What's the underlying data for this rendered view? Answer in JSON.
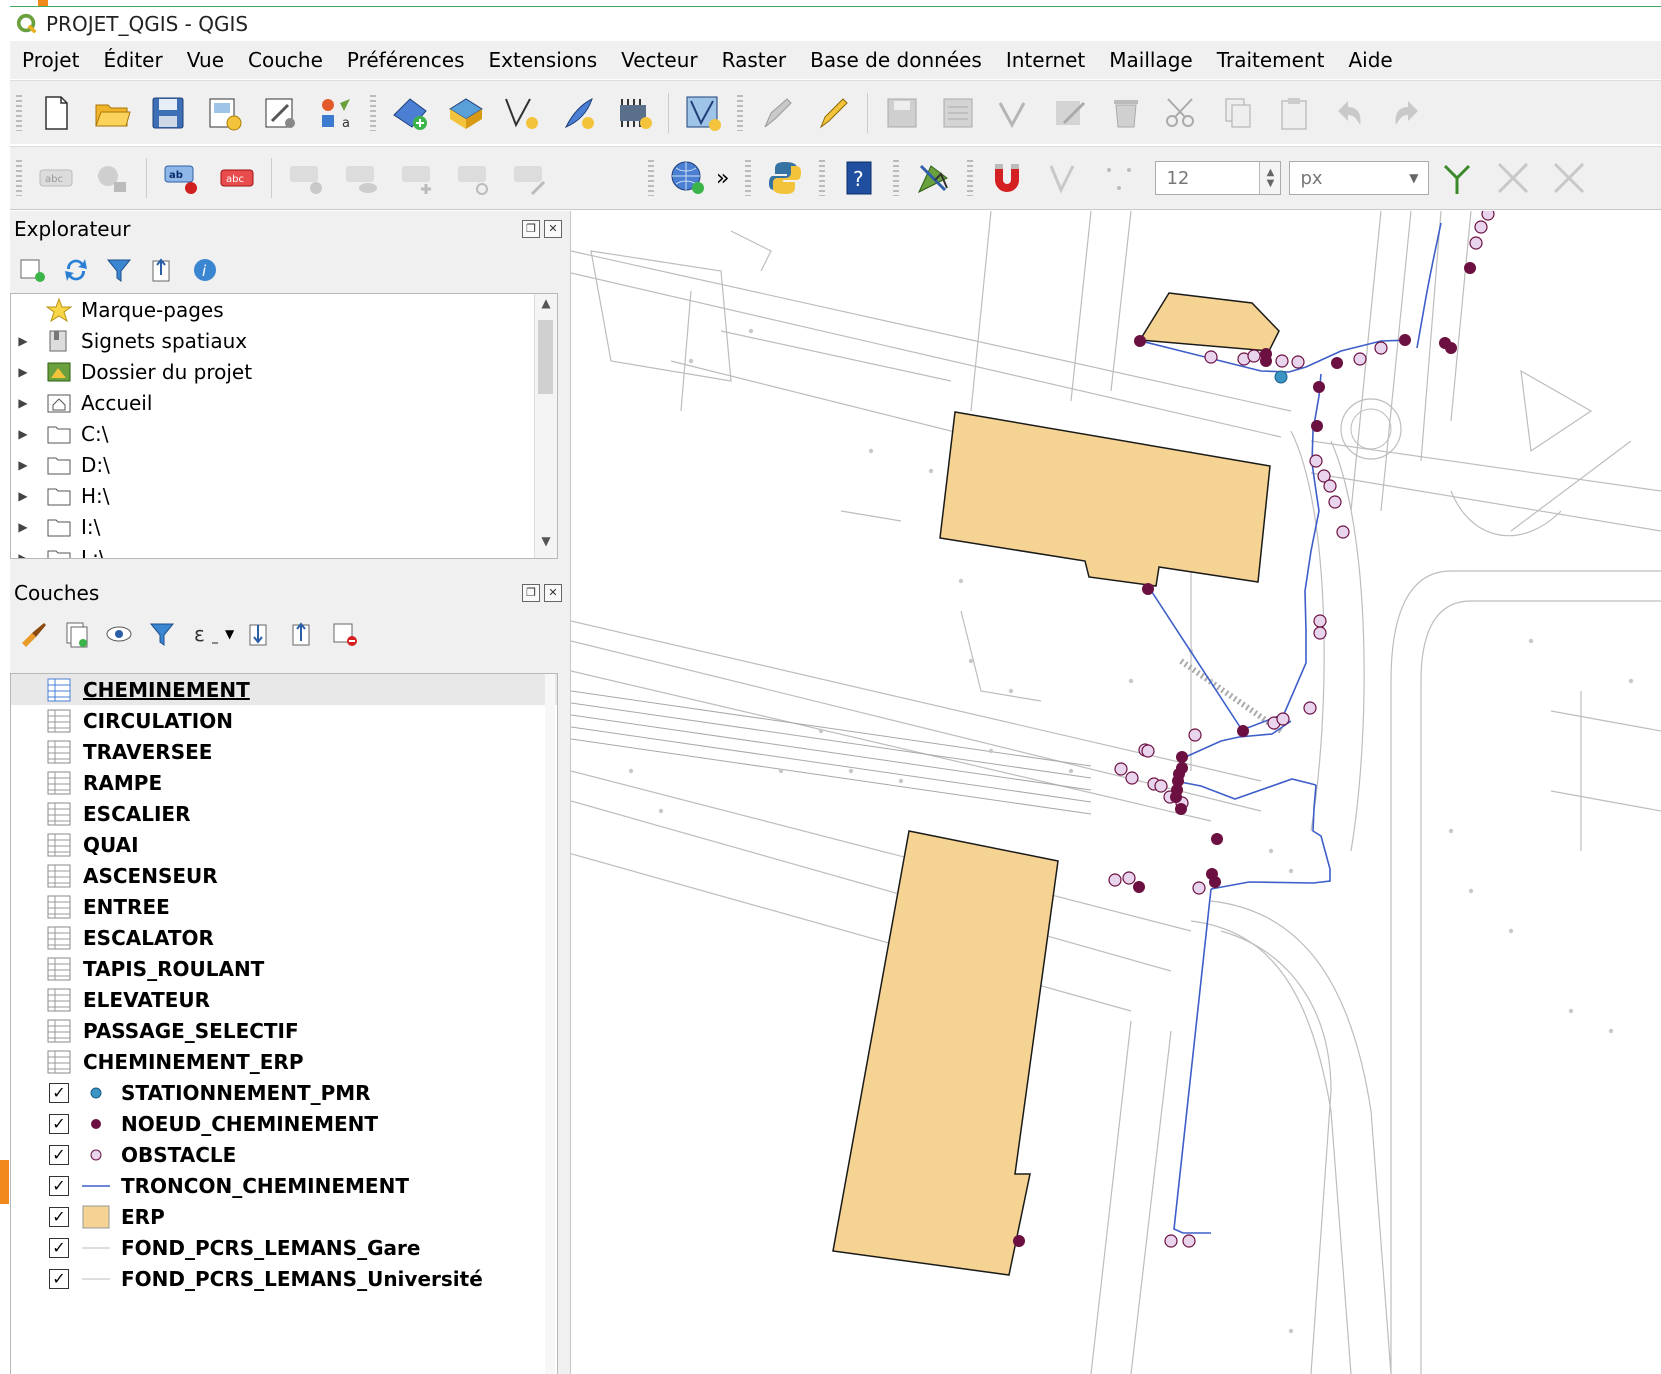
{
  "window": {
    "title": "PROJET_QGIS - QGIS"
  },
  "menu": [
    "Projet",
    "Éditer",
    "Vue",
    "Couche",
    "Préférences",
    "Extensions",
    "Vecteur",
    "Raster",
    "Base de données",
    "Internet",
    "Maillage",
    "Traitement",
    "Aide"
  ],
  "toolbar": {
    "tolerance_value": "12",
    "tolerance_unit": "px",
    "overflow_glyph": "»",
    "icons_row1": [
      "new-project-icon",
      "open-project-icon",
      "save-project-icon",
      "new-print-layout-icon",
      "layout-manager-icon",
      "style-manager-icon",
      "add-vector-layer-icon",
      "add-raster-layer-icon",
      "add-delimited-text-icon",
      "add-geopackage-icon",
      "add-spatialite-icon",
      "add-virtual-layer-icon",
      "current-edits-icon",
      "toggle-editing-icon",
      "save-edits-icon",
      "add-feature-icon",
      "vertex-tool-icon",
      "delete-selected-icon",
      "cut-features-icon",
      "copy-features-icon",
      "paste-features-icon",
      "undo-icon",
      "redo-icon"
    ],
    "icons_row2": [
      "label-toolbar-icon",
      "diagram-icon",
      "layer-labeling-icon",
      "layer-diagram-icon",
      "pin-label-icon",
      "show-hide-label-icon",
      "move-label-icon",
      "rotate-label-icon",
      "change-label-icon",
      "metasearch-icon",
      "python-console-icon",
      "help-icon",
      "snapping-topology-icon",
      "snapping-magnet-icon",
      "snapping-vertex-icon",
      "snapping-segment-icon",
      "trace-digitize-icon",
      "intersection-icon",
      "self-snap-icon"
    ]
  },
  "explorer": {
    "title": "Explorateur",
    "items": [
      {
        "label": "Marque-pages",
        "icon": "star-icon",
        "expandable": false
      },
      {
        "label": "Signets spatiaux",
        "icon": "spatial-bookmark-icon",
        "expandable": true
      },
      {
        "label": "Dossier du projet",
        "icon": "project-folder-icon",
        "expandable": true
      },
      {
        "label": "Accueil",
        "icon": "home-folder-icon",
        "expandable": true
      },
      {
        "label": "C:\\",
        "icon": "folder-icon",
        "expandable": true
      },
      {
        "label": "D:\\",
        "icon": "folder-icon",
        "expandable": true
      },
      {
        "label": "H:\\",
        "icon": "folder-icon",
        "expandable": true
      },
      {
        "label": "I:\\",
        "icon": "folder-icon",
        "expandable": true
      },
      {
        "label": "L:\\",
        "icon": "folder-icon",
        "expandable": true
      }
    ]
  },
  "layers": {
    "title": "Couches",
    "items": [
      {
        "name": "CHEMINEMENT",
        "kind": "table",
        "selected": true
      },
      {
        "name": "CIRCULATION",
        "kind": "table"
      },
      {
        "name": "TRAVERSEE",
        "kind": "table"
      },
      {
        "name": "RAMPE",
        "kind": "table"
      },
      {
        "name": "ESCALIER",
        "kind": "table"
      },
      {
        "name": "QUAI",
        "kind": "table"
      },
      {
        "name": "ASCENSEUR",
        "kind": "table"
      },
      {
        "name": "ENTREE",
        "kind": "table"
      },
      {
        "name": "ESCALATOR",
        "kind": "table"
      },
      {
        "name": "TAPIS_ROULANT",
        "kind": "table"
      },
      {
        "name": "ELEVATEUR",
        "kind": "table"
      },
      {
        "name": "PASSAGE_SELECTIF",
        "kind": "table"
      },
      {
        "name": "CHEMINEMENT_ERP",
        "kind": "table"
      },
      {
        "name": "STATIONNEMENT_PMR",
        "kind": "point-blue",
        "checked": true
      },
      {
        "name": "NOEUD_CHEMINEMENT",
        "kind": "point-dark",
        "checked": true
      },
      {
        "name": "OBSTACLE",
        "kind": "point-light",
        "checked": true
      },
      {
        "name": "TRONCON_CHEMINEMENT",
        "kind": "line-blue",
        "checked": true
      },
      {
        "name": "ERP",
        "kind": "polygon",
        "checked": true
      },
      {
        "name": "FOND_PCRS_LEMANS_Gare",
        "kind": "line-grey",
        "checked": true
      },
      {
        "name": "FOND_PCRS_LEMANS_Université",
        "kind": "line-grey",
        "checked": true
      }
    ]
  },
  "colors": {
    "erp_fill": "#f5d393",
    "node": "#6b1040",
    "obstacle": "#e9d4ee",
    "pmr": "#3a94c4",
    "troncon": "#3e5ec9",
    "basemap": "#bdbdbd",
    "check": "✓"
  }
}
